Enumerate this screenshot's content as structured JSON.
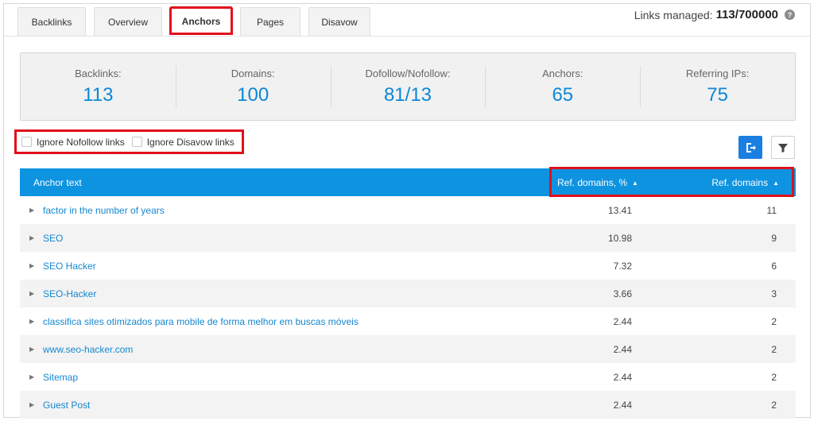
{
  "tabs": [
    {
      "label": "Backlinks",
      "active": false
    },
    {
      "label": "Overview",
      "active": false
    },
    {
      "label": "Anchors",
      "active": true
    },
    {
      "label": "Pages",
      "active": false
    },
    {
      "label": "Disavow",
      "active": false
    }
  ],
  "links_managed": {
    "label": "Links managed:",
    "value": "113/700000",
    "help_icon": "question-circle-icon"
  },
  "stats": [
    {
      "label": "Backlinks:",
      "value": "113"
    },
    {
      "label": "Domains:",
      "value": "100"
    },
    {
      "label": "Dofollow/Nofollow:",
      "value": "81/13"
    },
    {
      "label": "Anchors:",
      "value": "65"
    },
    {
      "label": "Referring IPs:",
      "value": "75"
    }
  ],
  "filters": [
    {
      "label": "Ignore Nofollow links",
      "checked": false
    },
    {
      "label": "Ignore Disavow links",
      "checked": false
    }
  ],
  "actions": {
    "export_icon": "export-icon",
    "filter_icon": "funnel-icon"
  },
  "table": {
    "headers": {
      "anchor": "Anchor text",
      "pct": "Ref. domains, %",
      "domains": "Ref. domains"
    },
    "rows": [
      {
        "anchor": "factor in the number of years",
        "pct": "13.41",
        "domains": "11"
      },
      {
        "anchor": "SEO",
        "pct": "10.98",
        "domains": "9"
      },
      {
        "anchor": "SEO Hacker",
        "pct": "7.32",
        "domains": "6"
      },
      {
        "anchor": "SEO-Hacker",
        "pct": "3.66",
        "domains": "3"
      },
      {
        "anchor": "classifica sites otimizados para mobile de forma melhor em buscas móveis",
        "pct": "2.44",
        "domains": "2"
      },
      {
        "anchor": "www.seo-hacker.com",
        "pct": "2.44",
        "domains": "2"
      },
      {
        "anchor": "Sitemap",
        "pct": "2.44",
        "domains": "2"
      },
      {
        "anchor": "Guest Post",
        "pct": "2.44",
        "domains": "2"
      }
    ]
  },
  "colors": {
    "accent": "#0d93e0",
    "highlight": "#e0101a",
    "link": "#1587d1"
  }
}
